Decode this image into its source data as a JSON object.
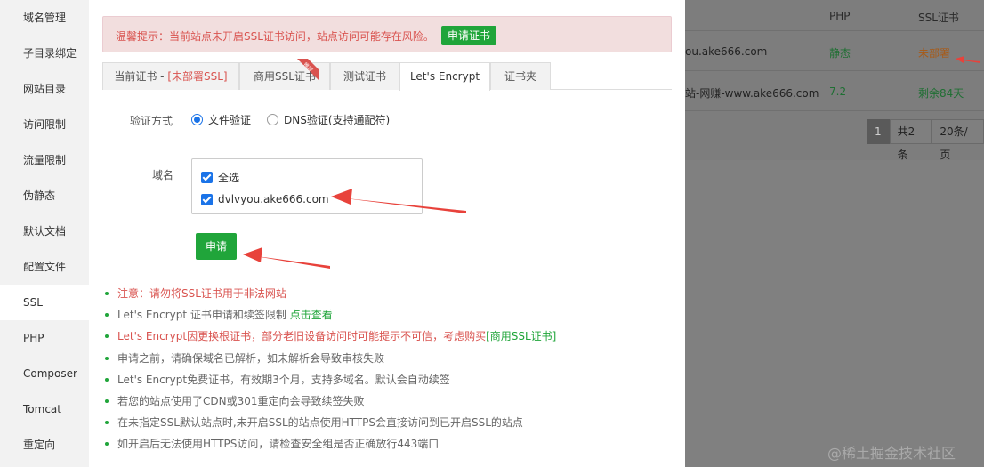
{
  "background": {
    "headers": {
      "php": "PHP",
      "ssl": "SSL证书"
    },
    "rows": [
      {
        "site": "ou.ake666.com",
        "php": "静态",
        "ssl": "未部署"
      },
      {
        "site": "站-网赚-www.ake666.com",
        "php": "7.2",
        "ssl": "剩余84天"
      }
    ],
    "pager": {
      "current": "1",
      "total": "共2条",
      "per_page": "20条/页"
    },
    "colors": {
      "php_text": "#1f6f33",
      "ssl_warn": "#a85a16",
      "ssl_ok": "#1f6f33"
    }
  },
  "sidebar": {
    "items": [
      {
        "label": "域名管理",
        "active": false
      },
      {
        "label": "子目录绑定",
        "active": false
      },
      {
        "label": "网站目录",
        "active": false
      },
      {
        "label": "访问限制",
        "active": false
      },
      {
        "label": "流量限制",
        "active": false
      },
      {
        "label": "伪静态",
        "active": false
      },
      {
        "label": "默认文档",
        "active": false
      },
      {
        "label": "配置文件",
        "active": false
      },
      {
        "label": "SSL",
        "active": true
      },
      {
        "label": "PHP",
        "active": false
      },
      {
        "label": "Composer",
        "active": false
      },
      {
        "label": "Tomcat",
        "active": false
      },
      {
        "label": "重定向",
        "active": false
      }
    ]
  },
  "alert": {
    "text": "温馨提示：当前站点未开启SSL证书访问，站点访问可能存在风险。",
    "button": "申请证书"
  },
  "tabs": {
    "current_prefix": "当前证书 - ",
    "current_status": "[未部署SSL]",
    "commercial": "商用SSL证书",
    "commercial_badge": "推荐",
    "test": "测试证书",
    "letsencrypt": "Let's Encrypt",
    "folder": "证书夹"
  },
  "form": {
    "verify_label": "验证方式",
    "verify_options": {
      "file": "文件验证",
      "dns": "DNS验证(支持通配符)"
    },
    "domain_label": "域名",
    "select_all": "全选",
    "domain": "dvlvyou.ake666.com",
    "apply_button": "申请"
  },
  "notes": {
    "n1": "注意：请勿将SSL证书用于非法网站",
    "n2_text": "Let's Encrypt 证书申请和续签限制 ",
    "n2_link": "点击查看",
    "n3_text": "Let's Encrypt因更换根证书，部分老旧设备访问时可能提示不可信，考虑购买",
    "n3_link": "[商用SSL证书]",
    "n4": "申请之前，请确保域名已解析，如未解析会导致审核失败",
    "n5": "Let's Encrypt免费证书，有效期3个月，支持多域名。默认会自动续签",
    "n6": "若您的站点使用了CDN或301重定向会导致续签失败",
    "n7": "在未指定SSL默认站点时,未开启SSL的站点使用HTTPS会直接访问到已开启SSL的站点",
    "n8": "如开启后无法使用HTTPS访问，请检查安全组是否正确放行443端口"
  },
  "watermark": "@稀土掘金技术社区",
  "colors": {
    "green": "#20a53a",
    "red": "#d9534f",
    "blue": "#1a73e8",
    "arrow": "#e8423b"
  }
}
